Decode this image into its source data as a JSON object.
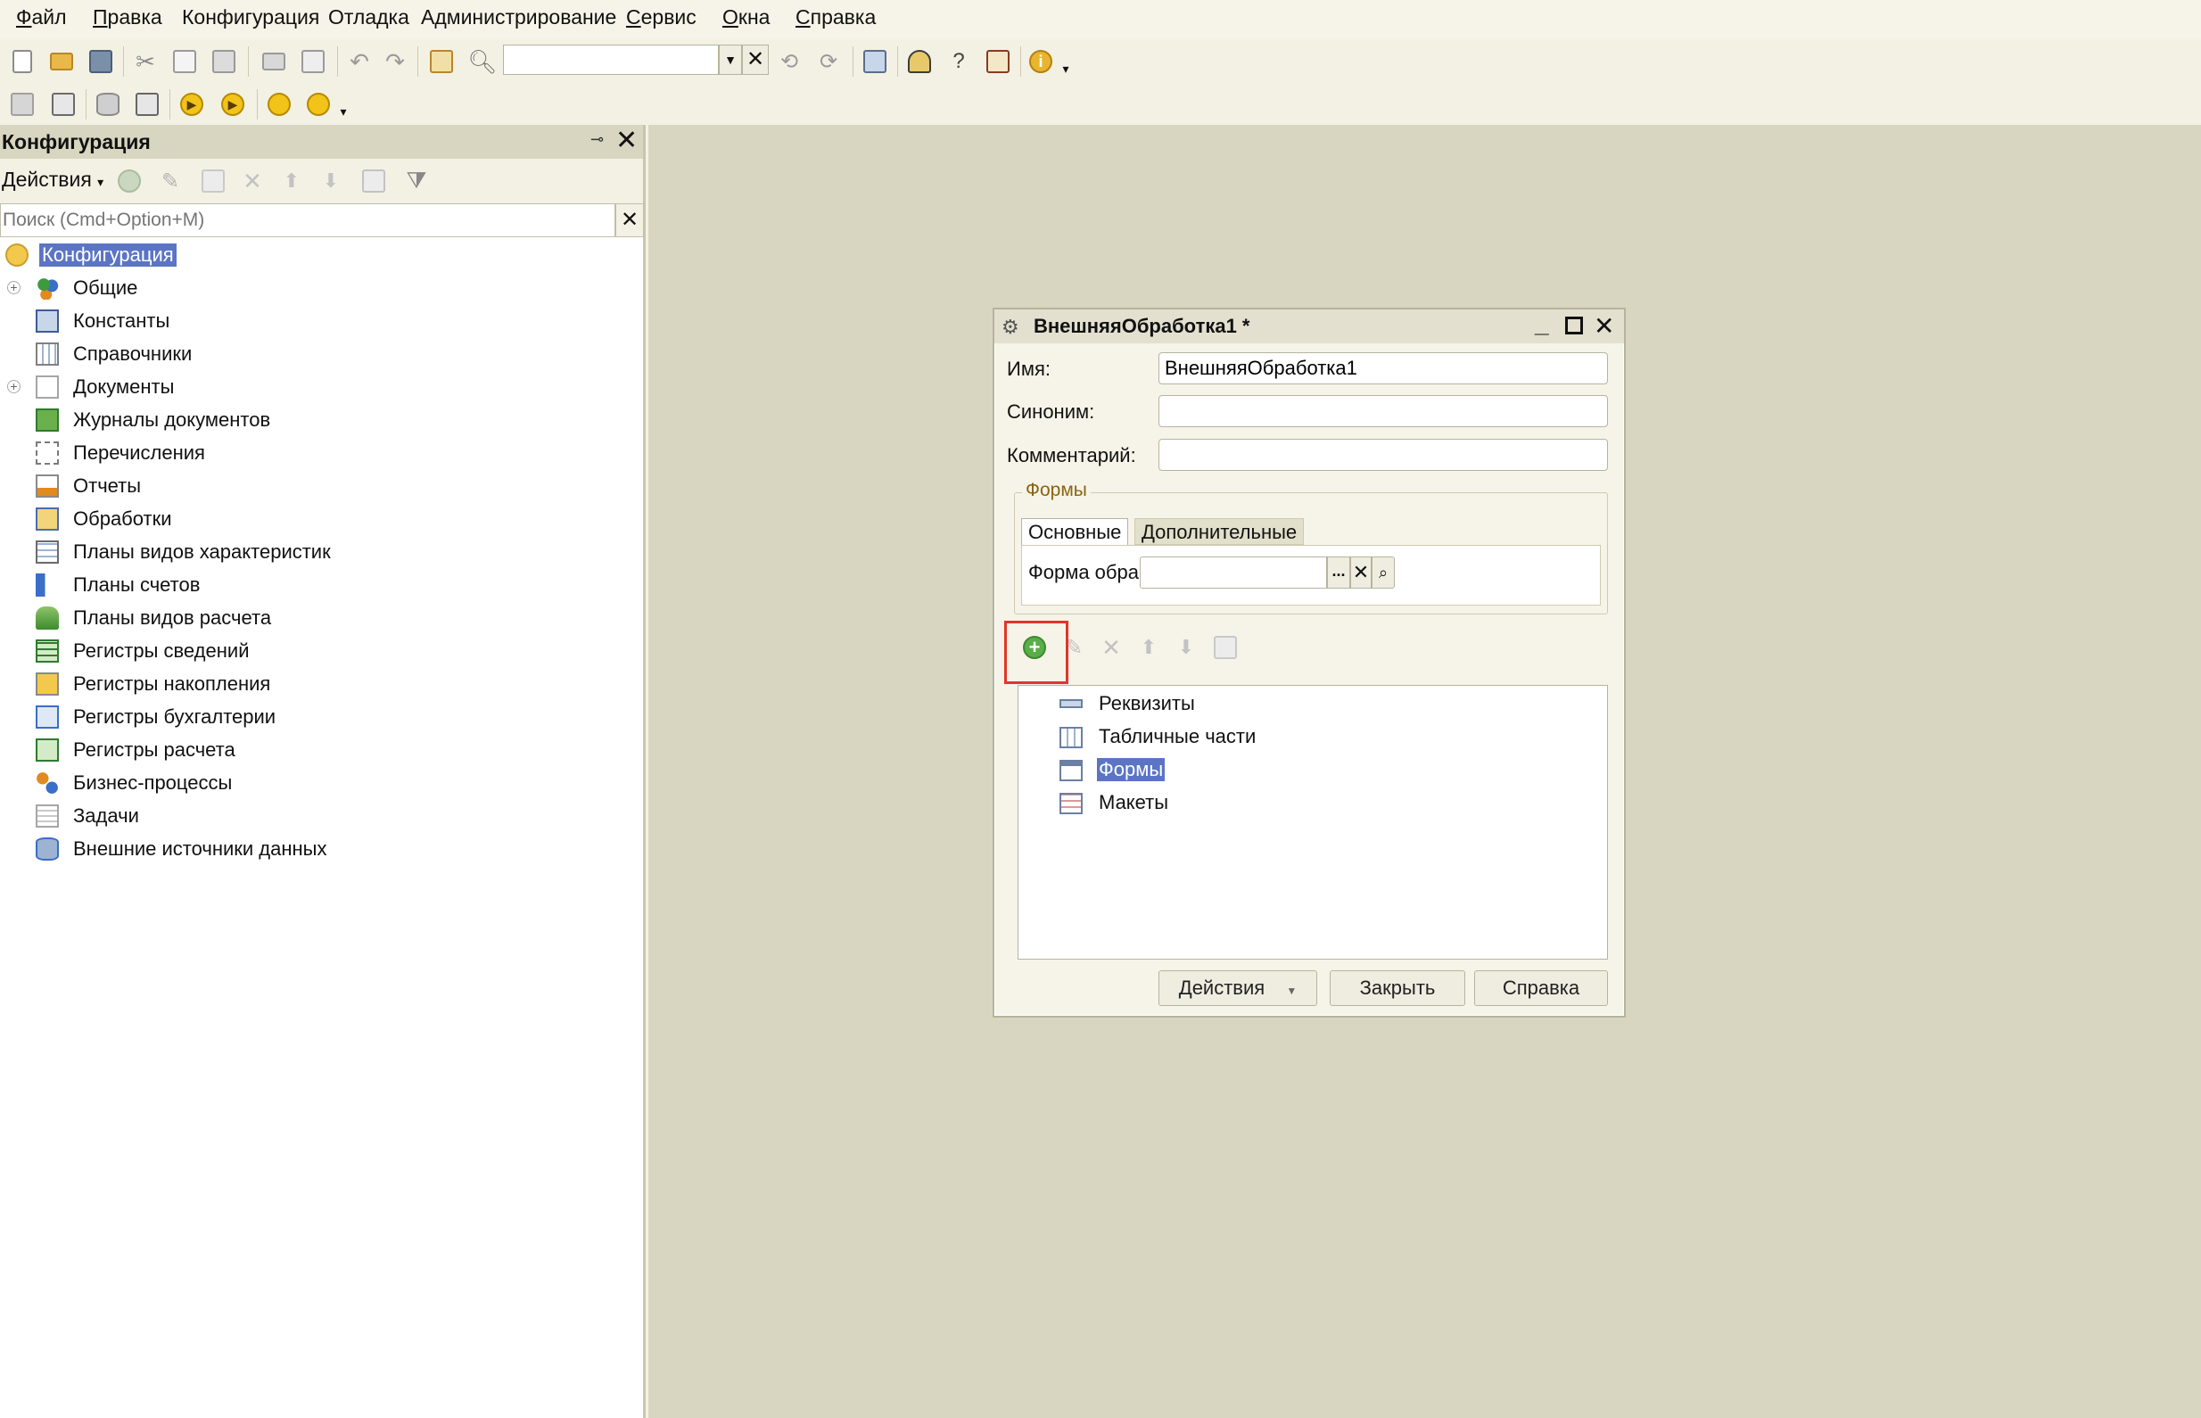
{
  "menubar": {
    "items": [
      {
        "label": "Файл",
        "underline_first": true
      },
      {
        "label": "Правка",
        "underline_first": true
      },
      {
        "label": "Конфигурация",
        "underline_first": false
      },
      {
        "label": "Отладка",
        "underline_first": false
      },
      {
        "label": "Администрирование",
        "underline_first": false
      },
      {
        "label": "Сервис",
        "underline_first": true
      },
      {
        "label": "Окна",
        "underline_first": true
      },
      {
        "label": "Справка",
        "underline_first": true
      }
    ]
  },
  "toolbar": {
    "search_value": ""
  },
  "config_panel": {
    "title": "Конфигурация",
    "actions_label": "Действия",
    "search_placeholder": "Поиск (Cmd+Option+M)",
    "root": "Конфигурация",
    "items": [
      {
        "label": "Общие",
        "expandable": true,
        "icon": "common-icon"
      },
      {
        "label": "Константы",
        "expandable": false,
        "icon": "constants-icon"
      },
      {
        "label": "Справочники",
        "expandable": false,
        "icon": "catalogs-icon"
      },
      {
        "label": "Документы",
        "expandable": true,
        "icon": "documents-icon"
      },
      {
        "label": "Журналы документов",
        "expandable": false,
        "icon": "document-journals-icon"
      },
      {
        "label": "Перечисления",
        "expandable": false,
        "icon": "enums-icon"
      },
      {
        "label": "Отчеты",
        "expandable": false,
        "icon": "reports-icon"
      },
      {
        "label": "Обработки",
        "expandable": false,
        "icon": "data-processors-icon"
      },
      {
        "label": "Планы видов характеристик",
        "expandable": false,
        "icon": "chart-of-characteristic-types-icon"
      },
      {
        "label": "Планы счетов",
        "expandable": false,
        "icon": "chart-of-accounts-icon"
      },
      {
        "label": "Планы видов расчета",
        "expandable": false,
        "icon": "chart-of-calculation-types-icon"
      },
      {
        "label": "Регистры сведений",
        "expandable": false,
        "icon": "information-registers-icon"
      },
      {
        "label": "Регистры накопления",
        "expandable": false,
        "icon": "accumulation-registers-icon"
      },
      {
        "label": "Регистры бухгалтерии",
        "expandable": false,
        "icon": "accounting-registers-icon"
      },
      {
        "label": "Регистры расчета",
        "expandable": false,
        "icon": "calculation-registers-icon"
      },
      {
        "label": "Бизнес-процессы",
        "expandable": false,
        "icon": "business-processes-icon"
      },
      {
        "label": "Задачи",
        "expandable": false,
        "icon": "tasks-icon"
      },
      {
        "label": "Внешние источники данных",
        "expandable": false,
        "icon": "external-data-sources-icon"
      }
    ]
  },
  "dialog": {
    "title": "ВнешняяОбработка1 *",
    "name_label": "Имя:",
    "name_value": "ВнешняяОбработка1",
    "synonym_label": "Синоним:",
    "synonym_value": "",
    "comment_label": "Комментарий:",
    "comment_value": "",
    "forms_group": "Формы",
    "tabs": [
      "Основные",
      "Дополнительные"
    ],
    "form_label": "Форма обработки:",
    "form_value": "",
    "form_dots": "...",
    "tree": [
      {
        "label": "Реквизиты",
        "icon": "attributes-icon",
        "selected": false
      },
      {
        "label": "Табличные части",
        "icon": "tabular-sections-icon",
        "selected": false
      },
      {
        "label": "Формы",
        "icon": "forms-icon",
        "selected": true
      },
      {
        "label": "Макеты",
        "icon": "templates-icon",
        "selected": false
      }
    ],
    "buttons": {
      "actions": "Действия",
      "close": "Закрыть",
      "help": "Справка"
    }
  },
  "colors": {
    "workspace_bg": "#d8d5c0",
    "selection": "#5b75c4",
    "highlight_frame": "#e2352b",
    "add_green": "#5aae48"
  }
}
